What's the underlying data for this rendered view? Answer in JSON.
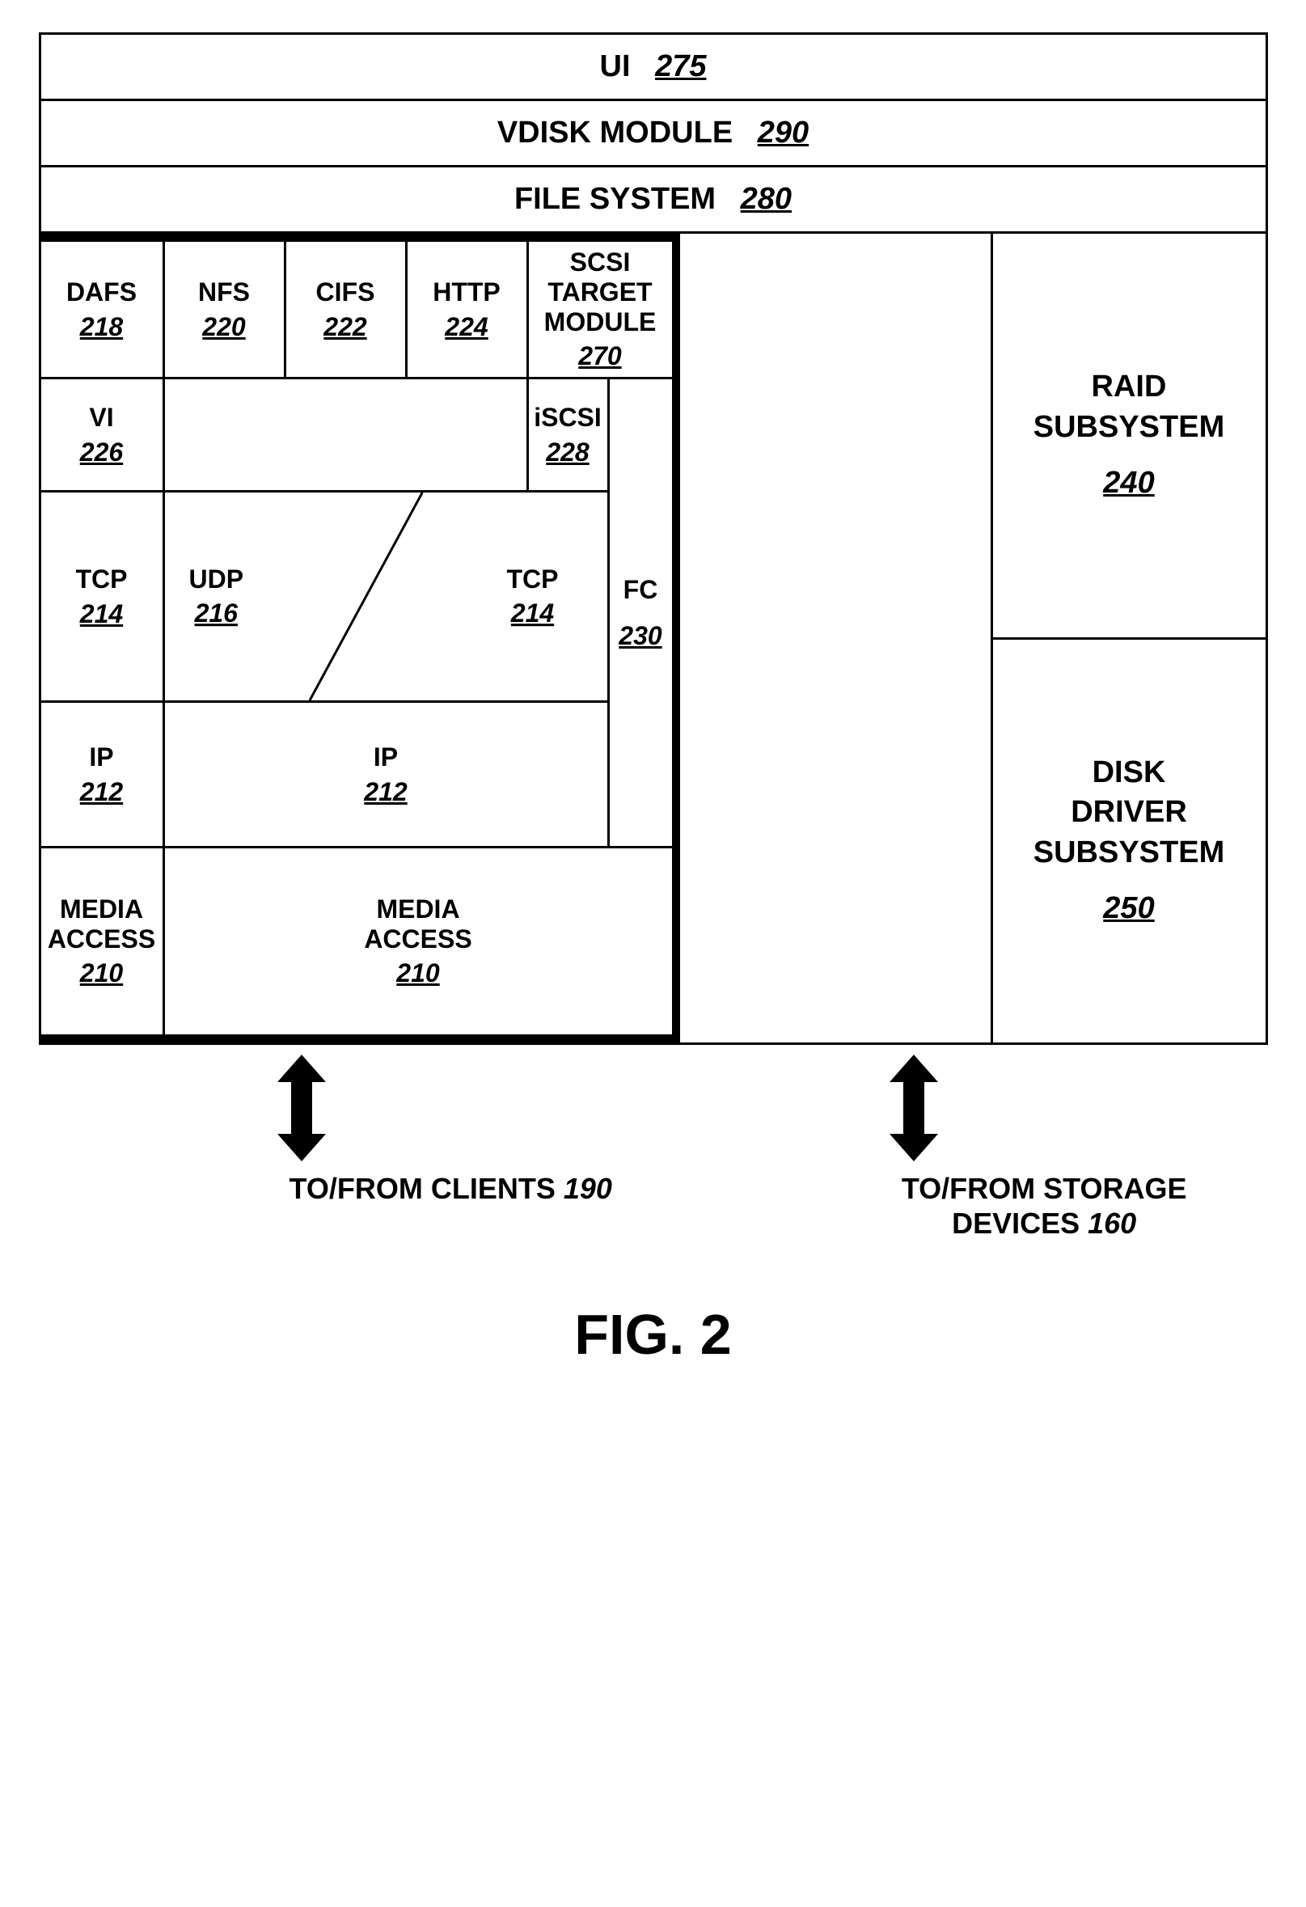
{
  "top": {
    "ui": {
      "label": "UI",
      "ref": "275"
    },
    "vdisk": {
      "label": "VDISK MODULE",
      "ref": "290"
    },
    "fs": {
      "label": "FILE SYSTEM",
      "ref": "280"
    }
  },
  "left": {
    "dafs": {
      "label": "DAFS",
      "ref": "218"
    },
    "nfs": {
      "label": "NFS",
      "ref": "220"
    },
    "cifs": {
      "label": "CIFS",
      "ref": "222"
    },
    "http": {
      "label": "HTTP",
      "ref": "224"
    },
    "scsi": {
      "label1": "SCSI TARGET",
      "label2": "MODULE",
      "ref": "270"
    },
    "vi": {
      "label": "VI",
      "ref": "226"
    },
    "iscsi": {
      "label": "iSCSI",
      "ref": "228"
    },
    "fc": {
      "label": "FC",
      "ref": "230"
    },
    "tcp": {
      "label": "TCP",
      "ref": "214"
    },
    "udp": {
      "label": "UDP",
      "ref": "216"
    },
    "ip": {
      "label": "IP",
      "ref": "212"
    },
    "media": {
      "label1": "MEDIA",
      "label2": "ACCESS",
      "ref": "210"
    }
  },
  "right": {
    "raid": {
      "label1": "RAID",
      "label2": "SUBSYSTEM",
      "ref": "240"
    },
    "disk": {
      "label1": "DISK",
      "label2": "DRIVER",
      "label3": "SUBSYSTEM",
      "ref": "250"
    }
  },
  "arrows": {
    "clients": {
      "label": "TO/FROM CLIENTS",
      "ref": "190"
    },
    "storage": {
      "label1": "TO/FROM STORAGE",
      "label2": "DEVICES",
      "ref": "160"
    }
  },
  "figure": "FIG. 2"
}
